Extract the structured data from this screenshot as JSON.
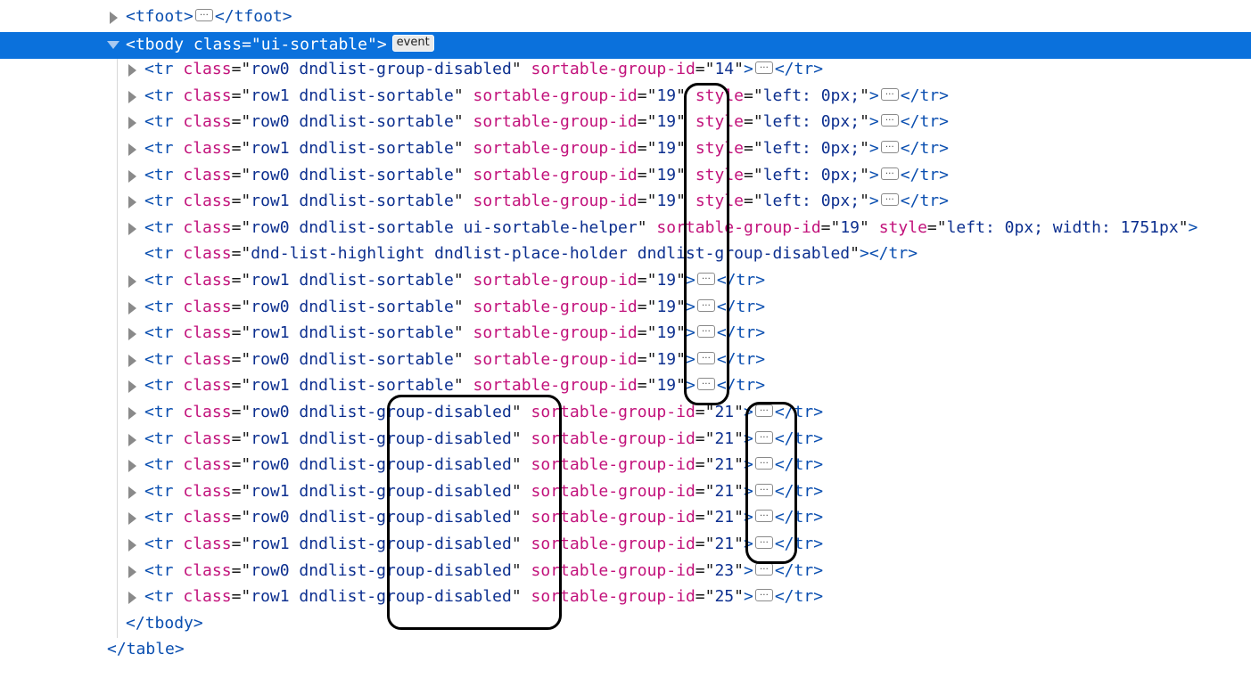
{
  "lines": [
    {
      "indent": 1,
      "twisty": "collapsed",
      "tag": "tfoot",
      "attrs": [],
      "collapsed_children": true,
      "close_tag": "tfoot"
    },
    {
      "indent": 1,
      "twisty": "expanded",
      "tag": "tbody",
      "attrs": [
        {
          "name": "class",
          "value": "ui-sortable"
        }
      ],
      "badge": "event",
      "selected": true
    },
    {
      "indent": 2,
      "twisty": "collapsed",
      "tag": "tr",
      "attrs": [
        {
          "name": "class",
          "value": "row0 dndlist-group-disabled"
        },
        {
          "name": "sortable-group-id",
          "value": "14"
        }
      ],
      "collapsed_children": true,
      "close_tag": "tr"
    },
    {
      "indent": 2,
      "twisty": "collapsed",
      "tag": "tr",
      "attrs": [
        {
          "name": "class",
          "value": "row1 dndlist-sortable"
        },
        {
          "name": "sortable-group-id",
          "value": "19"
        },
        {
          "name": "style",
          "value": "left: 0px;"
        }
      ],
      "collapsed_children": true,
      "close_tag": "tr"
    },
    {
      "indent": 2,
      "twisty": "collapsed",
      "tag": "tr",
      "attrs": [
        {
          "name": "class",
          "value": "row0 dndlist-sortable"
        },
        {
          "name": "sortable-group-id",
          "value": "19"
        },
        {
          "name": "style",
          "value": "left: 0px;"
        }
      ],
      "collapsed_children": true,
      "close_tag": "tr"
    },
    {
      "indent": 2,
      "twisty": "collapsed",
      "tag": "tr",
      "attrs": [
        {
          "name": "class",
          "value": "row1 dndlist-sortable"
        },
        {
          "name": "sortable-group-id",
          "value": "19"
        },
        {
          "name": "style",
          "value": "left: 0px;"
        }
      ],
      "collapsed_children": true,
      "close_tag": "tr"
    },
    {
      "indent": 2,
      "twisty": "collapsed",
      "tag": "tr",
      "attrs": [
        {
          "name": "class",
          "value": "row0 dndlist-sortable"
        },
        {
          "name": "sortable-group-id",
          "value": "19"
        },
        {
          "name": "style",
          "value": "left: 0px;"
        }
      ],
      "collapsed_children": true,
      "close_tag": "tr"
    },
    {
      "indent": 2,
      "twisty": "collapsed",
      "tag": "tr",
      "attrs": [
        {
          "name": "class",
          "value": "row1 dndlist-sortable"
        },
        {
          "name": "sortable-group-id",
          "value": "19"
        },
        {
          "name": "style",
          "value": "left: 0px;"
        }
      ],
      "collapsed_children": true,
      "close_tag": "tr"
    },
    {
      "indent": 2,
      "twisty": "collapsed",
      "tag": "tr",
      "attrs": [
        {
          "name": "class",
          "value": "row0 dndlist-sortable ui-sortable-helper"
        },
        {
          "name": "sortable-group-id",
          "value": "19"
        },
        {
          "name": "style",
          "value": "left: 0px; width: 1751px"
        }
      ],
      "open_only": true
    },
    {
      "indent": 2,
      "twisty": "none",
      "tag": "tr",
      "attrs": [
        {
          "name": "class",
          "value": "dnd-list-highlight dndlist-place-holder dndlist-group-disabled"
        }
      ],
      "close_tag": "tr"
    },
    {
      "indent": 2,
      "twisty": "collapsed",
      "tag": "tr",
      "attrs": [
        {
          "name": "class",
          "value": "row1 dndlist-sortable"
        },
        {
          "name": "sortable-group-id",
          "value": "19"
        }
      ],
      "collapsed_children": true,
      "close_tag": "tr"
    },
    {
      "indent": 2,
      "twisty": "collapsed",
      "tag": "tr",
      "attrs": [
        {
          "name": "class",
          "value": "row0 dndlist-sortable"
        },
        {
          "name": "sortable-group-id",
          "value": "19"
        }
      ],
      "collapsed_children": true,
      "close_tag": "tr"
    },
    {
      "indent": 2,
      "twisty": "collapsed",
      "tag": "tr",
      "attrs": [
        {
          "name": "class",
          "value": "row1 dndlist-sortable"
        },
        {
          "name": "sortable-group-id",
          "value": "19"
        }
      ],
      "collapsed_children": true,
      "close_tag": "tr"
    },
    {
      "indent": 2,
      "twisty": "collapsed",
      "tag": "tr",
      "attrs": [
        {
          "name": "class",
          "value": "row0 dndlist-sortable"
        },
        {
          "name": "sortable-group-id",
          "value": "19"
        }
      ],
      "collapsed_children": true,
      "close_tag": "tr"
    },
    {
      "indent": 2,
      "twisty": "collapsed",
      "tag": "tr",
      "attrs": [
        {
          "name": "class",
          "value": "row1 dndlist-sortable"
        },
        {
          "name": "sortable-group-id",
          "value": "19"
        }
      ],
      "collapsed_children": true,
      "close_tag": "tr"
    },
    {
      "indent": 2,
      "twisty": "collapsed",
      "tag": "tr",
      "attrs": [
        {
          "name": "class",
          "value": "row0 dndlist-group-disabled"
        },
        {
          "name": "sortable-group-id",
          "value": "21"
        }
      ],
      "collapsed_children": true,
      "close_tag": "tr"
    },
    {
      "indent": 2,
      "twisty": "collapsed",
      "tag": "tr",
      "attrs": [
        {
          "name": "class",
          "value": "row1 dndlist-group-disabled"
        },
        {
          "name": "sortable-group-id",
          "value": "21"
        }
      ],
      "collapsed_children": true,
      "close_tag": "tr"
    },
    {
      "indent": 2,
      "twisty": "collapsed",
      "tag": "tr",
      "attrs": [
        {
          "name": "class",
          "value": "row0 dndlist-group-disabled"
        },
        {
          "name": "sortable-group-id",
          "value": "21"
        }
      ],
      "collapsed_children": true,
      "close_tag": "tr"
    },
    {
      "indent": 2,
      "twisty": "collapsed",
      "tag": "tr",
      "attrs": [
        {
          "name": "class",
          "value": "row1 dndlist-group-disabled"
        },
        {
          "name": "sortable-group-id",
          "value": "21"
        }
      ],
      "collapsed_children": true,
      "close_tag": "tr"
    },
    {
      "indent": 2,
      "twisty": "collapsed",
      "tag": "tr",
      "attrs": [
        {
          "name": "class",
          "value": "row0 dndlist-group-disabled"
        },
        {
          "name": "sortable-group-id",
          "value": "21"
        }
      ],
      "collapsed_children": true,
      "close_tag": "tr"
    },
    {
      "indent": 2,
      "twisty": "collapsed",
      "tag": "tr",
      "attrs": [
        {
          "name": "class",
          "value": "row1 dndlist-group-disabled"
        },
        {
          "name": "sortable-group-id",
          "value": "21"
        }
      ],
      "collapsed_children": true,
      "close_tag": "tr"
    },
    {
      "indent": 2,
      "twisty": "collapsed",
      "tag": "tr",
      "attrs": [
        {
          "name": "class",
          "value": "row0 dndlist-group-disabled"
        },
        {
          "name": "sortable-group-id",
          "value": "23"
        }
      ],
      "collapsed_children": true,
      "close_tag": "tr"
    },
    {
      "indent": 2,
      "twisty": "collapsed",
      "tag": "tr",
      "attrs": [
        {
          "name": "class",
          "value": "row1 dndlist-group-disabled"
        },
        {
          "name": "sortable-group-id",
          "value": "25"
        }
      ],
      "collapsed_children": true,
      "close_tag": "tr"
    },
    {
      "indent": 1,
      "twisty": "none",
      "closing_only": true,
      "tag": "tbody"
    },
    {
      "indent": 0,
      "twisty": "none",
      "closing_only": true,
      "tag": "table"
    }
  ]
}
